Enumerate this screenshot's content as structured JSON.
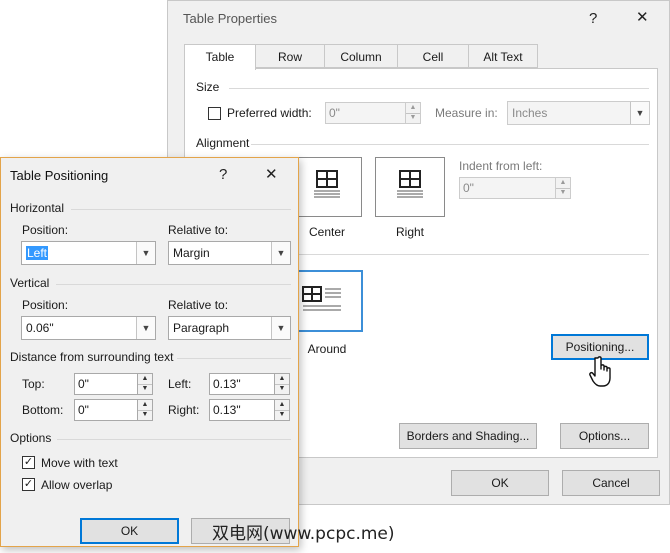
{
  "table_properties": {
    "title": "Table Properties",
    "help_glyph": "?",
    "close_glyph": "✕",
    "tabs": [
      {
        "label": "Table"
      },
      {
        "label": "Row"
      },
      {
        "label": "Column"
      },
      {
        "label": "Cell"
      },
      {
        "label": "Alt Text"
      }
    ],
    "size": {
      "section_label": "Size",
      "preferred_width_label": "Preferred width:",
      "preferred_width_value": "0\"",
      "measure_in_label": "Measure in:",
      "measure_in_value": "Inches"
    },
    "alignment": {
      "section_label": "Alignment",
      "center_label": "Center",
      "right_label": "Right",
      "indent_label": "Indent from left:",
      "indent_value": "0\""
    },
    "text_wrapping": {
      "around_label": "Around"
    },
    "positioning_button": "Positioning...",
    "borders_button": "Borders and Shading...",
    "options_button": "Options...",
    "ok_button": "OK",
    "cancel_button": "Cancel"
  },
  "table_positioning": {
    "title": "Table Positioning",
    "help_glyph": "?",
    "close_glyph": "✕",
    "horizontal": {
      "section_label": "Horizontal",
      "position_label": "Position:",
      "position_value": "Left",
      "relative_label": "Relative to:",
      "relative_value": "Margin"
    },
    "vertical": {
      "section_label": "Vertical",
      "position_label": "Position:",
      "position_value": "0.06\"",
      "relative_label": "Relative to:",
      "relative_value": "Paragraph"
    },
    "distance": {
      "section_label": "Distance from surrounding text",
      "top_label": "Top:",
      "top_value": "0\"",
      "bottom_label": "Bottom:",
      "bottom_value": "0\"",
      "left_label": "Left:",
      "left_value": "0.13\"",
      "right_label": "Right:",
      "right_value": "0.13\""
    },
    "options": {
      "section_label": "Options",
      "move_with_text_label": "Move with text",
      "move_with_text_checked": true,
      "allow_overlap_label": "Allow overlap",
      "allow_overlap_checked": true
    },
    "ok_button": "OK"
  },
  "watermark": "双电网(www.pcpc.me)",
  "colors": {
    "accent": "#0078d7",
    "dialog_bg": "#f0f0f0",
    "selection": "#3399ff"
  }
}
